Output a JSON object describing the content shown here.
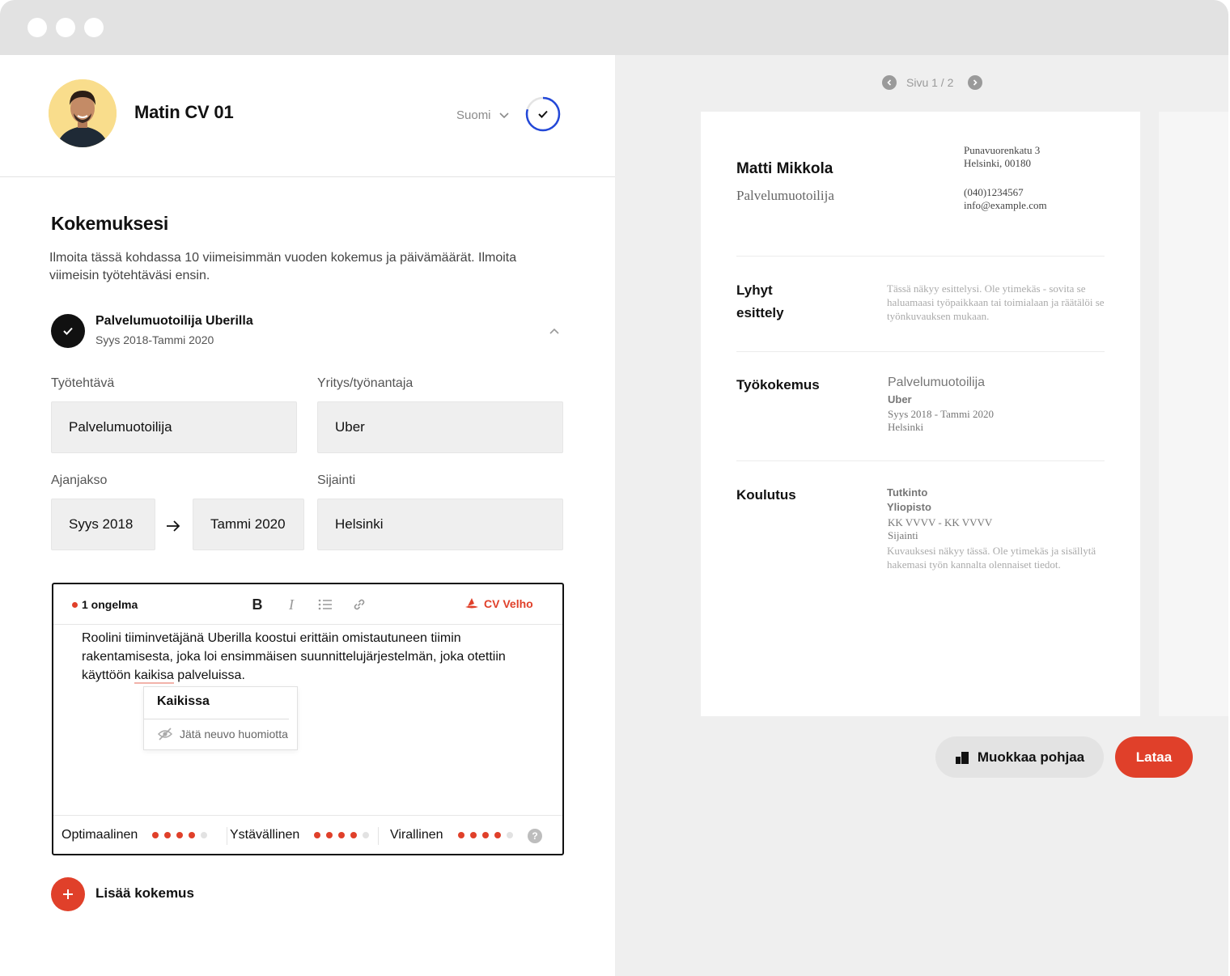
{
  "header": {
    "cv_title": "Matin CV 01",
    "language": "Suomi"
  },
  "section": {
    "title": "Kokemuksesi",
    "description": "Ilmoita tässä kohdassa 10 viimeisimmän vuoden kokemus ja päivämäärät. Ilmoita viimeisin työtehtäväsi ensin."
  },
  "experience": {
    "title": "Palvelumuotoilija Uberilla",
    "dates": "Syys 2018-Tammi 2020",
    "fields": {
      "job_label": "Työtehtävä",
      "job_value": "Palvelumuotoilija",
      "company_label": "Yritys/työnantaja",
      "company_value": "Uber",
      "period_label": "Ajanjakso",
      "start_value": "Syys 2018",
      "end_value": "Tammi 2020",
      "location_label": "Sijainti",
      "location_value": "Helsinki"
    }
  },
  "editor": {
    "issues": "1 ongelma",
    "bold": "B",
    "italic": "I",
    "assistant": "CV Velho",
    "text_before": "Roolini tiiminvetäjänä Uberilla koostui erittäin omistautuneen tiimin rakentamisesta, joka loi ensimmäisen suunnittelujärjestelmän, joka otettiin käyttöön ",
    "misspelled": "kaikisa",
    "text_after": " palveluissa.",
    "suggestion": "Kaikissa",
    "ignore": "Jätä neuvo huomiotta",
    "meters": [
      {
        "label": "Optimaalinen",
        "level": 4,
        "max": 5
      },
      {
        "label": "Ystävällinen",
        "level": 4,
        "max": 5
      },
      {
        "label": "Virallinen",
        "level": 4,
        "max": 5
      }
    ],
    "help": "?"
  },
  "add_experience": "Lisää kokemus",
  "preview": {
    "pager": "Sivu 1 / 2",
    "name": "Matti Mikkola",
    "role": "Palvelumuotoilija",
    "address_line1": "Punavuorenkatu 3",
    "address_line2": "Helsinki, 00180",
    "phone": "(040)1234567",
    "email": "info@example.com",
    "summary_heading_1": "Lyhyt",
    "summary_heading_2": "esittely",
    "summary_placeholder": "Tässä näkyy esittelysi. Ole ytimekäs - sovita se haluamaasi työpaikkaan tai toimialaan ja räätälöi se työnkuvauksen mukaan.",
    "work_heading": "Työkokemus",
    "work_title": "Palvelumuotoilija",
    "work_company": "Uber",
    "work_dates": "Syys 2018 - Tammi 2020",
    "work_location": "Helsinki",
    "edu_heading": "Koulutus",
    "edu_degree": "Tutkinto",
    "edu_school": "Yliopisto",
    "edu_dates": "KK VVVV - KK VVVV",
    "edu_location": "Sijainti",
    "edu_placeholder": "Kuvauksesi näkyy tässä. Ole ytimekäs ja sisällytä hakemasi työn kannalta olennaiset tiedot."
  },
  "actions": {
    "edit_template": "Muokkaa pohjaa",
    "download": "Lataa"
  },
  "colors": {
    "accent": "#e0402a",
    "progress_ring": "#2348d8",
    "avatar_bg": "#f9dd8c"
  }
}
